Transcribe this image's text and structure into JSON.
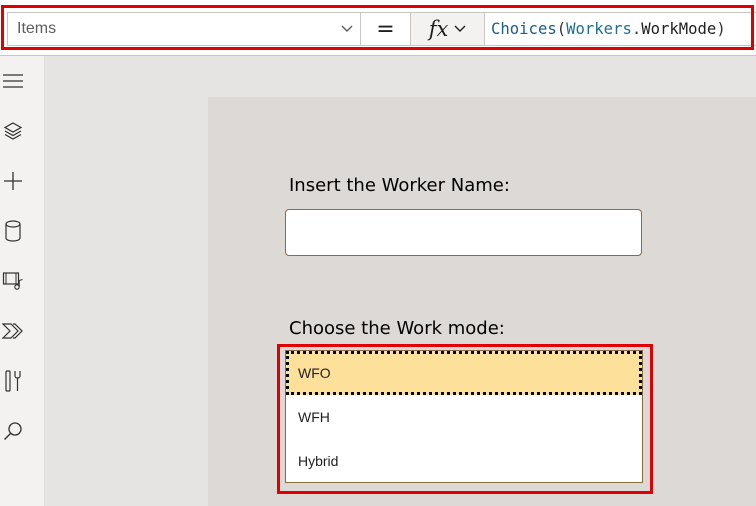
{
  "formula_bar": {
    "property": "Items",
    "equals": "=",
    "fx": "fx",
    "formula": {
      "fn": "Choices",
      "open": "(",
      "ref": "Workers",
      "dot": ".",
      "field": "WorkMode",
      "close": ")"
    }
  },
  "left_rail": {
    "icons": [
      "hamburger-menu-icon",
      "layers-icon",
      "plus-icon",
      "database-icon",
      "media-icon",
      "power-automate-icon",
      "tools-icon",
      "search-icon"
    ]
  },
  "form": {
    "name_label": "Insert the Worker Name:",
    "name_value": "",
    "mode_label": "Choose the Work mode:",
    "options": [
      "WFO",
      "WFH",
      "Hybrid"
    ],
    "selected": "WFO"
  },
  "colors": {
    "highlight": "#e00000",
    "selected_bg": "#fde19a",
    "control_border": "#8a6d3b"
  }
}
